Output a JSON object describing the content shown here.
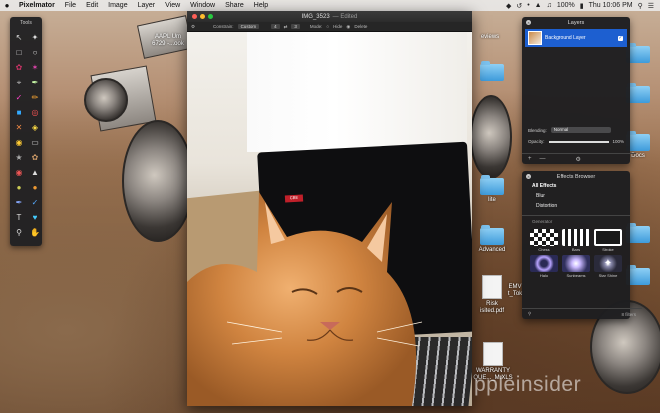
{
  "menubar": {
    "apple_icon": "apple-icon",
    "app_name": "Pixelmator",
    "menus": [
      "File",
      "Edit",
      "Image",
      "Layer",
      "View",
      "Window",
      "Share",
      "Help"
    ],
    "battery": "100%",
    "clock": "Thu 10:06 PM"
  },
  "tools_palette": {
    "title": "Tools"
  },
  "image_window": {
    "title": "IMG_3523",
    "status": "— Edited",
    "toolbar": {
      "label_constrain": "Constrain:",
      "constrain_value": "Custom",
      "width_value": "4",
      "height_value": "3",
      "label_mode": "Mode:",
      "mode_hide": "Hide",
      "mode_delete": "Delete"
    },
    "laptop_label": "CBE"
  },
  "layers_panel": {
    "title": "Layers",
    "layers": [
      {
        "name": "Background Layer",
        "visible": true
      }
    ],
    "blending_label": "Blending:",
    "blending_value": "Normal",
    "opacity_label": "Opacity:",
    "opacity_value": "100%",
    "opacity_fraction": 1.0,
    "footer_add": "+",
    "footer_remove": "—"
  },
  "effects_browser": {
    "title": "Effects Browser",
    "categories": [
      "All Effects",
      "Blur",
      "Distortion"
    ],
    "section_label": "Generator",
    "effects": [
      {
        "name": "Chess",
        "colors": [
          "#ffffff",
          "#1a1a1a"
        ]
      },
      {
        "name": "Bars",
        "colors": [
          "#ffffff",
          "#1a1a1a"
        ]
      },
      {
        "name": "Stroke",
        "colors": [
          "#ffffff",
          "#1a1a1a"
        ]
      },
      {
        "name": "Halo",
        "colors": [
          "#b8a4ff",
          "#2a2a55"
        ]
      },
      {
        "name": "Sunbeams",
        "colors": [
          "#c9b8ff",
          "#30305c"
        ]
      },
      {
        "name": "Star Shine",
        "colors": [
          "#ffffff",
          "#2a2a3a"
        ]
      }
    ],
    "effect_count": "8 filters"
  },
  "desktop_icons": [
    {
      "label_line1": "AAPL Um",
      "label_line2": "6729 -...ook",
      "type": "doc"
    },
    {
      "label_line1": "eviews",
      "label_line2": "",
      "type": "folder"
    },
    {
      "label_line1": "Docs",
      "label_line2": "",
      "type": "folder"
    },
    {
      "label_line1": "lite",
      "label_line2": "",
      "type": "folder"
    },
    {
      "label_line1": "Advanced",
      "label_line2": "",
      "type": "folder"
    },
    {
      "label_line1": "Risk",
      "label_line2": "isited.pdf",
      "type": "doc"
    },
    {
      "label_line1": "EMV",
      "label_line2": "t_Tok",
      "type": "doc"
    },
    {
      "label_line1": "WARRANTY",
      "label_line2": "QUE..._M.XLS",
      "type": "doc"
    }
  ],
  "watermark": "ppleinsider",
  "colors": {
    "selection_blue": "#1d5fd0",
    "panel_bg": "#1e1e20",
    "traffic_red": "#fc5f57",
    "traffic_yellow": "#fdbb2e",
    "traffic_green": "#28c840"
  }
}
